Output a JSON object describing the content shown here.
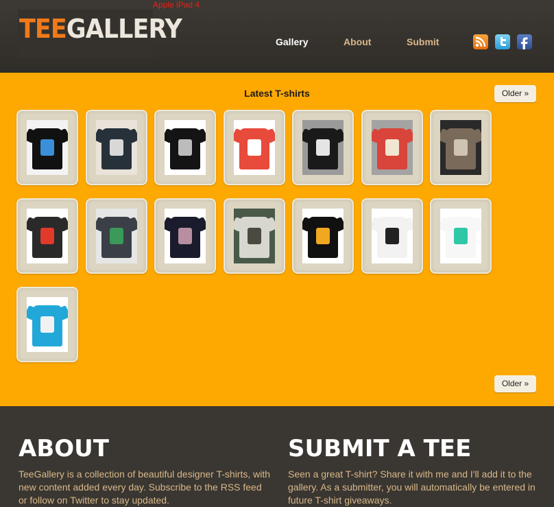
{
  "header": {
    "logo_tee": "TEE",
    "logo_gallery": "GALLERY",
    "device_label": "Apple iPad 4",
    "nav": {
      "gallery": "Gallery",
      "about": "About",
      "submit": "Submit"
    },
    "social_icons": [
      "rss-icon",
      "twitter-icon",
      "facebook-icon"
    ]
  },
  "main": {
    "title": "Latest T-shirts",
    "older_label": "Older »",
    "shirts": [
      {
        "shirt": "#111111",
        "print": "#3b8fd9",
        "bg": "#f3f3f3"
      },
      {
        "shirt": "#27313a",
        "print": "#d8d8d8",
        "bg": "#e9e3da"
      },
      {
        "shirt": "#141414",
        "print": "#bcbcbc",
        "bg": "#ffffff"
      },
      {
        "shirt": "#e84a3c",
        "print": "#ffffff",
        "bg": "#ffffff"
      },
      {
        "shirt": "#1a1a1a",
        "print": "#e5e5e5",
        "bg": "#9a9a9a"
      },
      {
        "shirt": "#d9443b",
        "print": "#f1e6d0",
        "bg": "#a3a3a3"
      },
      {
        "shirt": "#7a6a5a",
        "print": "#cfc4b2",
        "bg": "#2a2a2a"
      },
      {
        "shirt": "#2a2a2a",
        "print": "#e03a2a",
        "bg": "#ffffff"
      },
      {
        "shirt": "#3b3f47",
        "print": "#3a9a5a",
        "bg": "#e6e6e6"
      },
      {
        "shirt": "#1b1b2e",
        "print": "#b78fa0",
        "bg": "#ffffff"
      },
      {
        "shirt": "#d7d7cf",
        "print": "#4a4a3e",
        "bg": "#4a5a4a"
      },
      {
        "shirt": "#111111",
        "print": "#f0a820",
        "bg": "#ffffff"
      },
      {
        "shirt": "#f2f2f2",
        "print": "#222222",
        "bg": "#ffffff"
      },
      {
        "shirt": "#f7f7f7",
        "print": "#2fc7a6",
        "bg": "#ffffff"
      },
      {
        "shirt": "#22a8d8",
        "print": "#f1f1f1",
        "bg": "#ffffff"
      }
    ]
  },
  "footer": {
    "about_title": "ABOUT",
    "about_text": "TeeGallery is a collection of beautiful designer T-shirts, with new content added every day. Subscribe to the RSS feed or follow on Twitter to stay updated.",
    "submit_title": "SUBMIT A TEE",
    "submit_text": "Seen a great T-shirt? Share it with me and I'll add it to the gallery. As a submitter, you will automatically be entered in future T-shirt giveaways."
  },
  "colors": {
    "accent_orange": "#fea902",
    "header_bg": "#3a3631",
    "nav_inactive": "#d9b98a",
    "logo_tee": "#f07a1a"
  }
}
